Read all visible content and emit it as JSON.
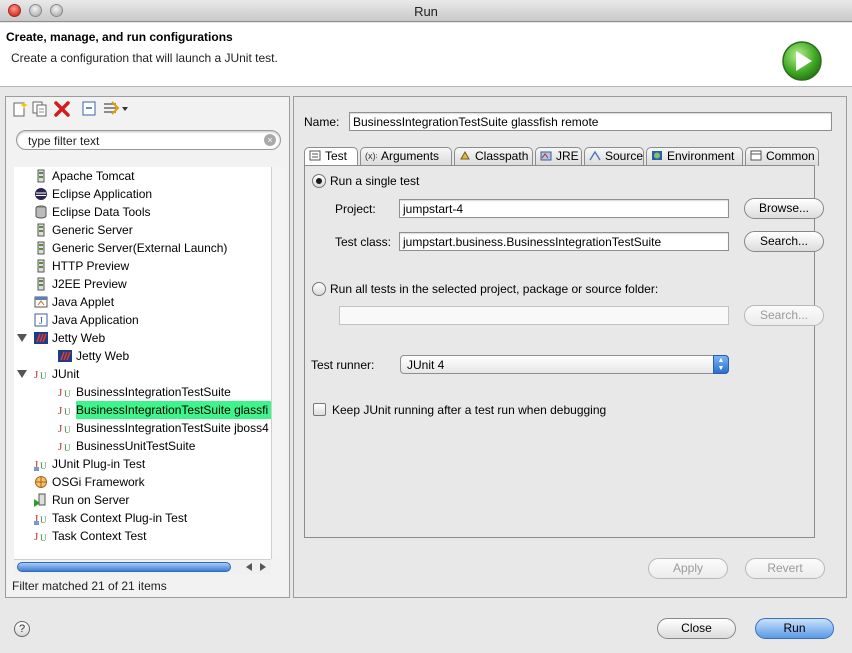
{
  "window": {
    "title": "Run"
  },
  "header": {
    "title": "Create, manage, and run configurations",
    "message": "Create a configuration that will launch a JUnit test.",
    "icon": "run-icon"
  },
  "left_toolbar": {
    "icons": [
      "new-configuration-icon",
      "duplicate-icon",
      "delete-icon",
      "collapse-all-icon",
      "filter-icon"
    ]
  },
  "filter": {
    "placeholder": "type filter text"
  },
  "tree": {
    "items": [
      {
        "label": "Apache Tomcat",
        "icon": "tomcat-icon"
      },
      {
        "label": "Eclipse Application",
        "icon": "eclipse-icon"
      },
      {
        "label": "Eclipse Data Tools",
        "icon": "database-icon"
      },
      {
        "label": "Generic Server",
        "icon": "server-icon"
      },
      {
        "label": "Generic Server(External Launch)",
        "icon": "server-icon"
      },
      {
        "label": "HTTP Preview",
        "icon": "server-icon"
      },
      {
        "label": "J2EE Preview",
        "icon": "server-icon"
      },
      {
        "label": "Java Applet",
        "icon": "applet-icon"
      },
      {
        "label": "Java Application",
        "icon": "java-app-icon"
      },
      {
        "label": "Jetty Web",
        "icon": "jetty-icon",
        "expanded": true
      },
      {
        "label": "Jetty Web",
        "icon": "jetty-icon",
        "child": true
      },
      {
        "label": "JUnit",
        "icon": "junit-icon",
        "expanded": true
      },
      {
        "label": "BusinessIntegrationTestSuite",
        "icon": "junit-icon",
        "child": true
      },
      {
        "label": "BusinessIntegrationTestSuite glassfi",
        "icon": "junit-icon",
        "child": true,
        "selected": true
      },
      {
        "label": "BusinessIntegrationTestSuite jboss4",
        "icon": "junit-icon",
        "child": true
      },
      {
        "label": "BusinessUnitTestSuite",
        "icon": "junit-icon",
        "child": true
      },
      {
        "label": "JUnit Plug-in Test",
        "icon": "junit-plugin-icon"
      },
      {
        "label": "OSGi Framework",
        "icon": "osgi-icon"
      },
      {
        "label": "Run on Server",
        "icon": "run-on-server-icon"
      },
      {
        "label": "Task Context Plug-in Test",
        "icon": "junit-plugin-icon"
      },
      {
        "label": "Task Context Test",
        "icon": "junit-icon"
      }
    ]
  },
  "filter_status": "Filter matched 21 of 21 items",
  "config": {
    "name_label": "Name:",
    "name_value": "BusinessIntegrationTestSuite glassfish remote",
    "tabs": [
      {
        "label": "Test",
        "icon": "test-tab-icon"
      },
      {
        "label": "Arguments",
        "icon": "arguments-icon"
      },
      {
        "label": "Classpath",
        "icon": "classpath-icon"
      },
      {
        "label": "JRE",
        "icon": "jre-icon"
      },
      {
        "label": "Source",
        "icon": "source-icon"
      },
      {
        "label": "Environment",
        "icon": "environment-icon"
      },
      {
        "label": "Common",
        "icon": "common-icon"
      }
    ],
    "active_tab": "Test",
    "run_single_label": "Run a single test",
    "run_single_selected": true,
    "project_label": "Project:",
    "project_value": "jumpstart-4",
    "browse_label": "Browse...",
    "test_class_label": "Test class:",
    "test_class_value": "jumpstart.business.BusinessIntegrationTestSuite",
    "search_label": "Search...",
    "run_all_label": "Run all tests in the selected project, package or source folder:",
    "run_all_value": "",
    "search2_label": "Search...",
    "test_runner_label": "Test runner:",
    "test_runner_value": "JUnit 4",
    "keep_running_label": "Keep JUnit running after a test run when debugging",
    "keep_running_checked": false,
    "apply_label": "Apply",
    "revert_label": "Revert"
  },
  "footer": {
    "help_icon": "help-icon",
    "help_glyph": "?",
    "close_label": "Close",
    "run_label": "Run"
  }
}
